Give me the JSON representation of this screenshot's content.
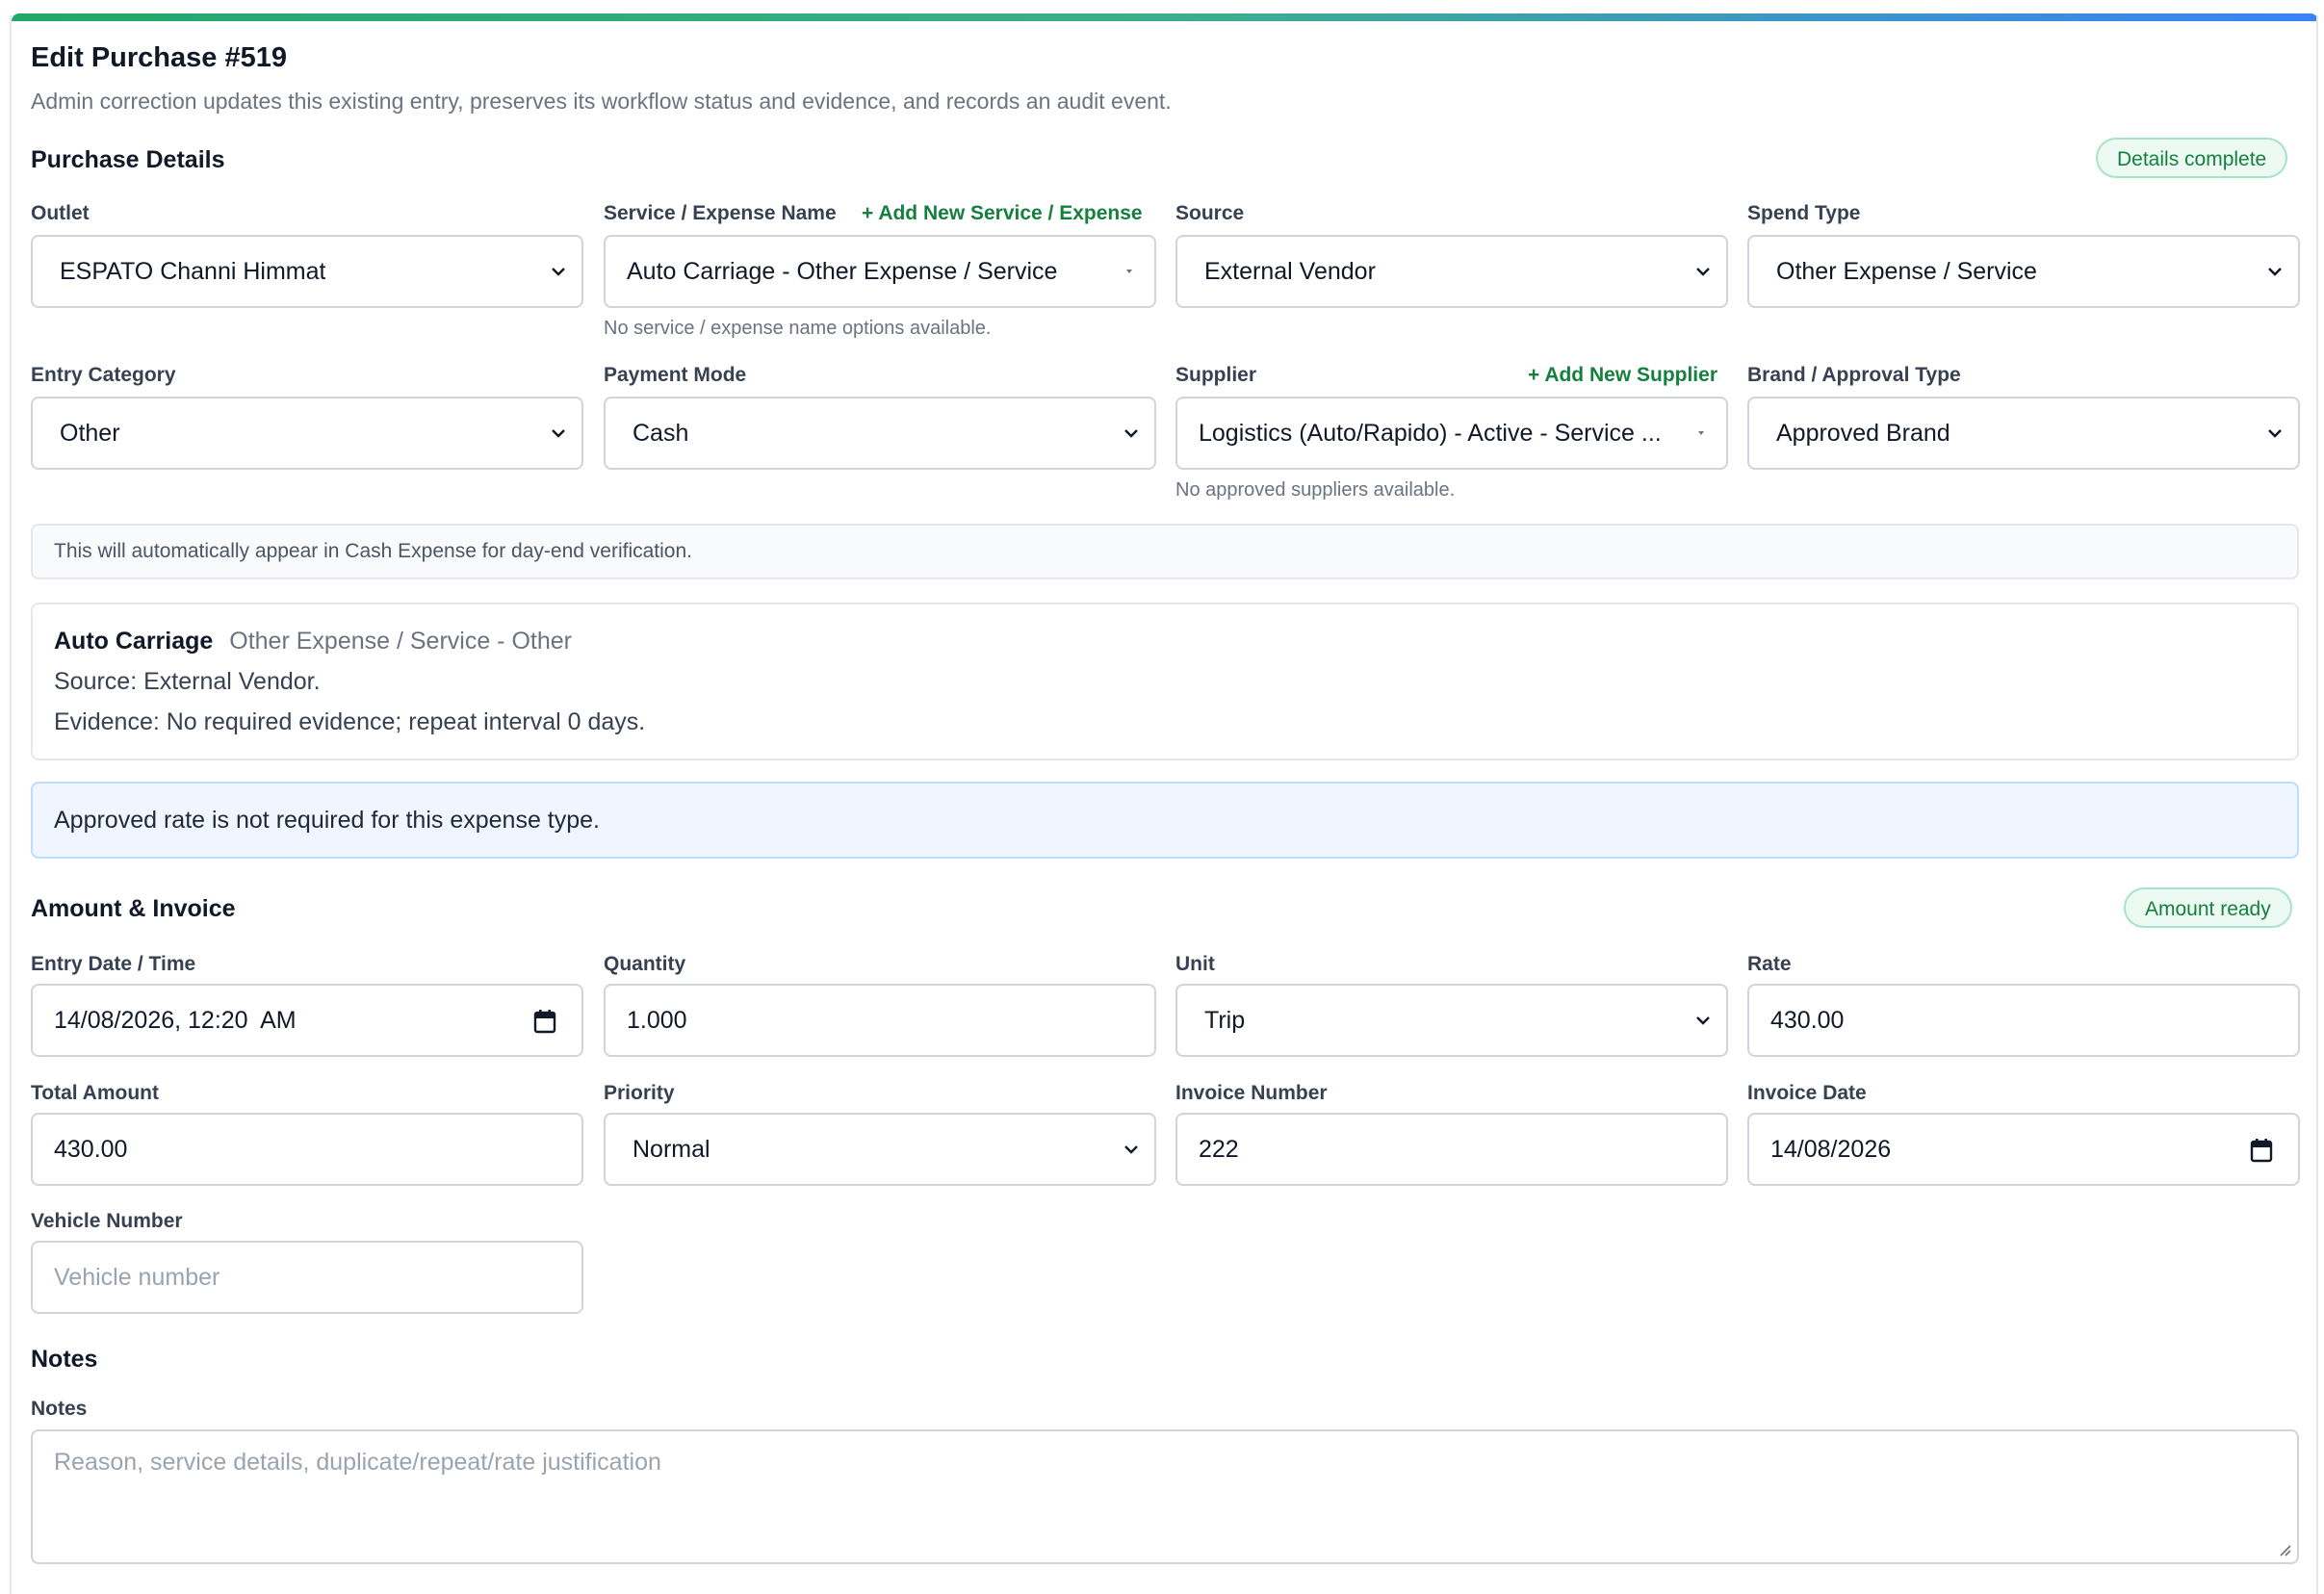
{
  "header": {
    "title": "Edit Purchase #519",
    "subtitle": "Admin correction updates this existing entry, preserves its workflow status and evidence, and records an audit event."
  },
  "purchase_details": {
    "section_title": "Purchase Details",
    "status_pill": "Details complete",
    "outlet": {
      "label": "Outlet",
      "value": "ESPATO Channi Himmat"
    },
    "service": {
      "label": "Service / Expense Name",
      "add_link": "+ Add New Service / Expense",
      "value": "Auto Carriage - Other Expense / Service",
      "hint": "No service / expense name options available."
    },
    "source": {
      "label": "Source",
      "value": "External Vendor"
    },
    "spend_type": {
      "label": "Spend Type",
      "value": "Other Expense / Service"
    },
    "entry_category": {
      "label": "Entry Category",
      "value": "Other"
    },
    "payment_mode": {
      "label": "Payment Mode",
      "value": "Cash"
    },
    "supplier": {
      "label": "Supplier",
      "add_link": "+ Add New Supplier",
      "value": "Logistics (Auto/Rapido) - Active - Service ...",
      "hint": "No approved suppliers available."
    },
    "brand": {
      "label": "Brand / Approval Type",
      "value": "Approved Brand"
    },
    "cash_note": "This will automatically appear in Cash Expense for day-end verification.",
    "info": {
      "name": "Auto Carriage",
      "meta": "Other Expense / Service - Other",
      "source_line": "Source: External Vendor.",
      "evidence_line": "Evidence: No required evidence; repeat interval 0 days."
    },
    "rate_note": "Approved rate is not required for this expense type."
  },
  "amount_invoice": {
    "section_title": "Amount & Invoice",
    "status_pill": "Amount ready",
    "entry_datetime": {
      "label": "Entry Date / Time",
      "value": "14/08/2026, 12:20  AM"
    },
    "quantity": {
      "label": "Quantity",
      "value": "1.000"
    },
    "unit": {
      "label": "Unit",
      "value": "Trip"
    },
    "rate": {
      "label": "Rate",
      "value": "430.00"
    },
    "total_amount": {
      "label": "Total Amount",
      "value": "430.00"
    },
    "priority": {
      "label": "Priority",
      "value": "Normal"
    },
    "invoice_number": {
      "label": "Invoice Number",
      "value": "222"
    },
    "invoice_date": {
      "label": "Invoice Date",
      "value": "14/08/2026"
    },
    "vehicle_number": {
      "label": "Vehicle Number",
      "placeholder": "Vehicle number"
    }
  },
  "notes": {
    "section_title": "Notes",
    "label": "Notes",
    "placeholder": "Reason, service details, duplicate/repeat/rate justification"
  }
}
